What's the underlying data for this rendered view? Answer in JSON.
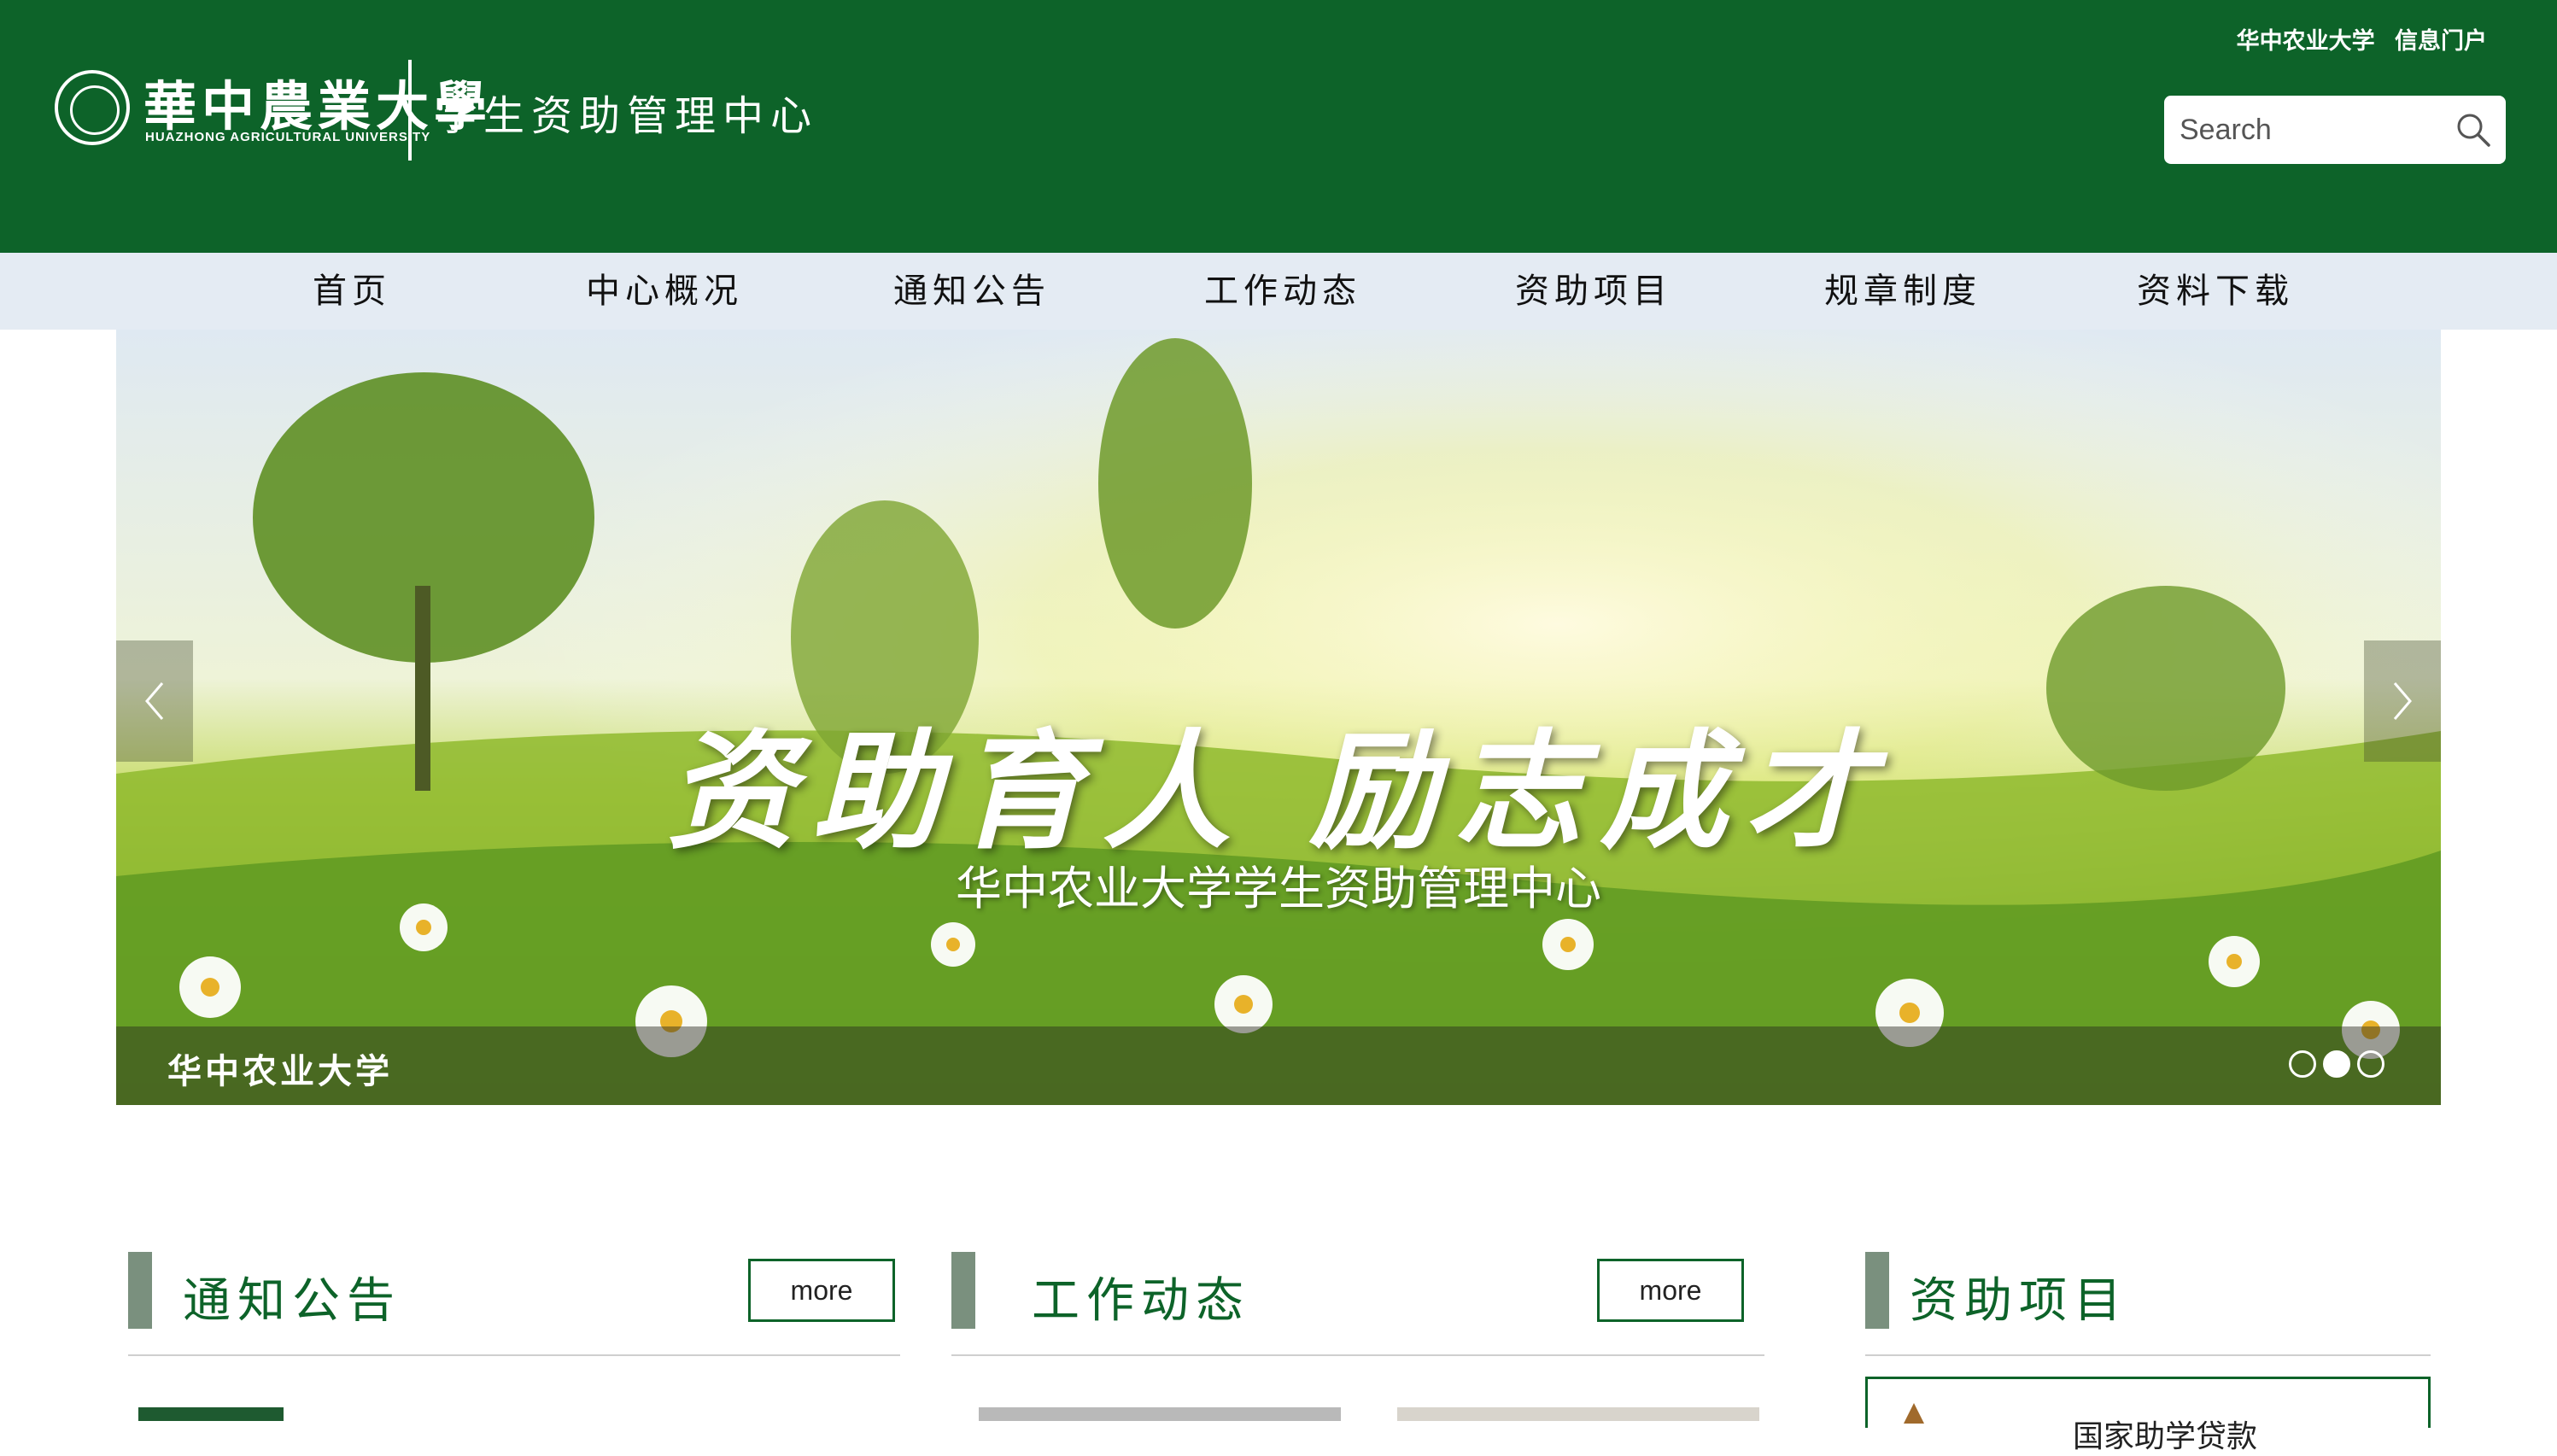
{
  "header": {
    "logo_cn": "華中農業大學",
    "logo_en": "HUAZHONG  AGRICULTURAL  UNIVERSITY",
    "site_title": "学生资助管理中心",
    "top_links": [
      "华中农业大学",
      "信息门户"
    ],
    "search_placeholder": "Search"
  },
  "nav": {
    "items": [
      "首页",
      "中心概况",
      "通知公告",
      "工作动态",
      "资助项目",
      "规章制度",
      "资料下载"
    ]
  },
  "banner": {
    "slogan": "资助育人 励志成才",
    "subtitle": "华中农业大学学生资助管理中心",
    "caption": "华中农业大学",
    "active_dot": 2,
    "dot_count": 3
  },
  "sections": {
    "notice": {
      "title": "通知公告",
      "more_label": "more"
    },
    "work": {
      "title": "工作动态",
      "more_label": "more"
    },
    "projects": {
      "title": "资助项目",
      "first_item": "国家助学贷款"
    }
  },
  "colors": {
    "brand_green": "#0d6329",
    "nav_bg": "#e4ebf3",
    "section_bar": "#7a907e"
  },
  "icons": {
    "search": "search-icon",
    "prev": "chevron-left-icon",
    "next": "chevron-right-icon",
    "logo": "university-emblem-icon"
  }
}
